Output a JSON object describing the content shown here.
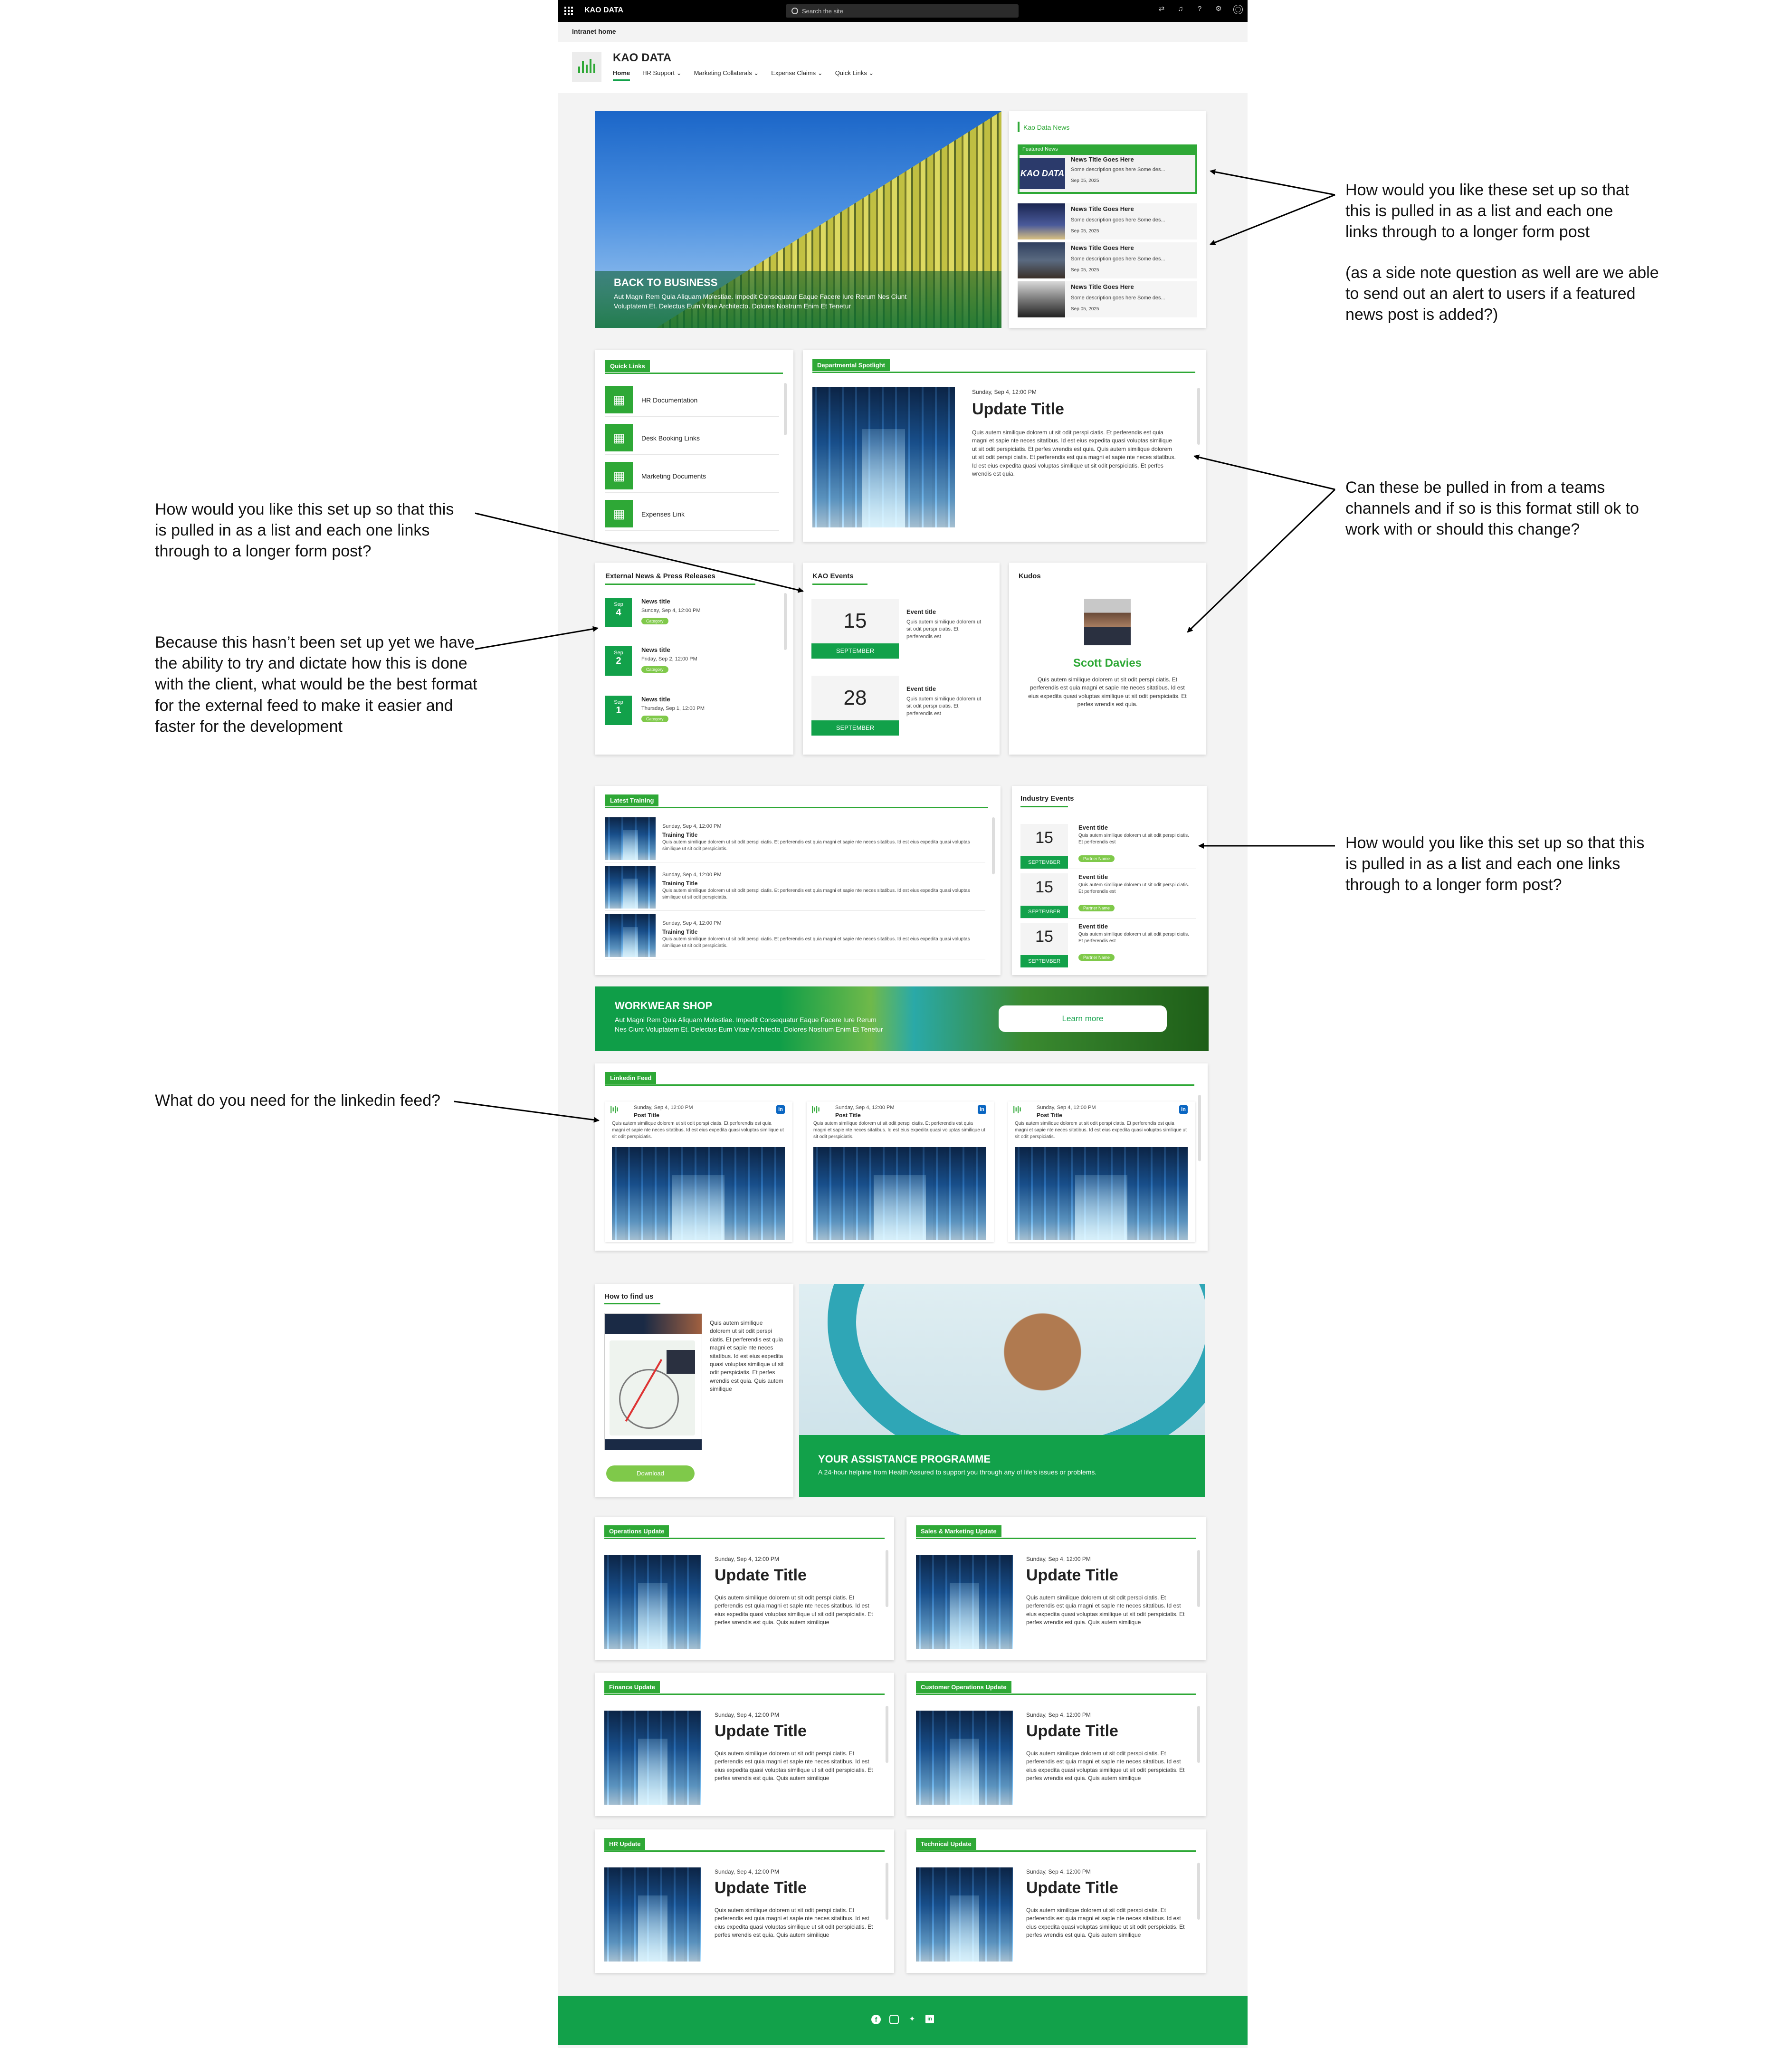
{
  "topbar": {
    "brand": "KAO DATA",
    "search_placeholder": "Search the site",
    "icons": [
      "share-icon",
      "bell-icon",
      "help-icon",
      "settings-icon",
      "account-icon"
    ]
  },
  "breadcrumb": "Intranet home",
  "header": {
    "title": "KAO DATA",
    "nav": [
      "Home",
      "HR Support",
      "Marketing Collaterals",
      "Expense Claims",
      "Quick Links"
    ]
  },
  "hero": {
    "title": "BACK TO BUSINESS",
    "text_line1": "Aut Magni Rem Quia Aliquam Molestiae. Impedit Consequatur Eaque Facere Iure Rerum Nes Ciunt",
    "text_line2": "Voluptatem Et. Delectus Eum Vitae Architecto. Dolores Nostrum Enim Et Tenetur"
  },
  "news": {
    "heading": "Kao Data News",
    "featured_label": "Featured News",
    "items": [
      {
        "title": "News Title Goes Here",
        "desc": "Some description goes here Some des...",
        "date": "Sep 05, 2025"
      },
      {
        "title": "News Title Goes Here",
        "desc": "Some description goes here Some des...",
        "date": "Sep 05, 2025"
      },
      {
        "title": "News Title Goes Here",
        "desc": "Some description goes here Some des...",
        "date": "Sep 05, 2025"
      },
      {
        "title": "News Title Goes Here",
        "desc": "Some description goes here Some des...",
        "date": "Sep 05, 2025"
      }
    ]
  },
  "quick_links": {
    "heading": "Quick Links",
    "items": [
      "HR Documentation",
      "Desk Booking Links",
      "Marketing Documents",
      "Expenses Link"
    ]
  },
  "spotlight": {
    "heading": "Departmental Spotlight",
    "date": "Sunday, Sep 4, 12:00 PM",
    "title": "Update Title",
    "body": "Quis autem similique dolorem ut sit odit perspi ciatis. Et perferendis est quia magni et sapie nte neces sitatibus. Id est eius expedita quasi voluptas similique ut sit odit perspiciatis. Et perfes wrendis est quia. Quis autem similique dolorem ut sit odit perspi ciatis. Et perferendis est quia magni et sapie nte neces sitatibus. Id est eius expedita quasi voluptas similique ut sit odit perspiciatis. Et perfes wrendis est quia."
  },
  "external_news": {
    "heading": "External News & Press Releases",
    "items": [
      {
        "month": "Sep",
        "day": "4",
        "title": "News title",
        "date": "Sunday, Sep 4, 12:00 PM",
        "tag": "Category"
      },
      {
        "month": "Sep",
        "day": "2",
        "title": "News title",
        "date": "Friday, Sep 2, 12:00 PM",
        "tag": "Category"
      },
      {
        "month": "Sep",
        "day": "1",
        "title": "News title",
        "date": "Thursday, Sep 1, 12:00 PM",
        "tag": "Category"
      }
    ]
  },
  "kao_events": {
    "heading": "KAO Events",
    "items": [
      {
        "day": "15",
        "month": "SEPTEMBER",
        "title": "Event title",
        "desc": "Quis autem similique dolorem ut sit odit perspi ciatis. Et perferendis est"
      },
      {
        "day": "28",
        "month": "SEPTEMBER",
        "title": "Event title",
        "desc": "Quis autem similique dolorem ut sit odit perspi ciatis. Et perferendis est"
      }
    ]
  },
  "kudos": {
    "heading": "Kudos",
    "name": "Scott Davies",
    "body": "Quis autem similique dolorem ut sit odit perspi ciatis. Et perferendis est quia magni et sapie nte neces sitatibus. Id est eius expedita quasi voluptas similique ut sit odit perspiciatis. Et perfes wrendis est quia."
  },
  "training": {
    "heading": "Latest Training",
    "items": [
      {
        "date": "Sunday, Sep 4, 12:00 PM",
        "title": "Training Title",
        "body": "Quis autem similique dolorem ut sit odit perspi ciatis. Et perferendis est quia magni et sapie nte neces sitatibus. Id est eius expedita quasi voluptas similique ut sit odit perspiciatis."
      },
      {
        "date": "Sunday, Sep 4, 12:00 PM",
        "title": "Training Title",
        "body": "Quis autem similique dolorem ut sit odit perspi ciatis. Et perferendis est quia magni et sapie nte neces sitatibus. Id est eius expedita quasi voluptas similique ut sit odit perspiciatis."
      },
      {
        "date": "Sunday, Sep 4, 12:00 PM",
        "title": "Training Title",
        "body": "Quis autem similique dolorem ut sit odit perspi ciatis. Et perferendis est quia magni et sapie nte neces sitatibus. Id est eius expedita quasi voluptas similique ut sit odit perspiciatis."
      }
    ]
  },
  "industry_events": {
    "heading": "Industry Events",
    "items": [
      {
        "day": "15",
        "month": "SEPTEMBER",
        "title": "Event title",
        "desc": "Quis autem similique dolorem ut sit odit perspi ciatis. Et perferendis est",
        "tag": "Partner Name"
      },
      {
        "day": "15",
        "month": "SEPTEMBER",
        "title": "Event title",
        "desc": "Quis autem similique dolorem ut sit odit perspi ciatis. Et perferendis est",
        "tag": "Partner Name"
      },
      {
        "day": "15",
        "month": "SEPTEMBER",
        "title": "Event title",
        "desc": "Quis autem similique dolorem ut sit odit perspi ciatis. Et perferendis est",
        "tag": "Partner Name"
      }
    ]
  },
  "workwear": {
    "title": "WORKWEAR SHOP",
    "line1": "Aut Magni Rem Quia Aliquam Molestiae. Impedit Consequatur Eaque Facere Iure Rerum",
    "line2": "Nes Ciunt Voluptatem Et. Delectus Eum Vitae Architecto. Dolores Nostrum Enim Et Tenetur",
    "button": "Learn more"
  },
  "linkedin": {
    "heading": "Linkedin Feed",
    "posts": [
      {
        "date": "Sunday, Sep 4, 12:00 PM",
        "title": "Post Title",
        "body": "Quis autem similique dolorem ut sit odit perspi ciatis. Et perferendis est quia magni et sapie nte neces sitatibus. Id est eius expedita quasi voluptas similique ut sit odit perspiciatis."
      },
      {
        "date": "Sunday, Sep 4, 12:00 PM",
        "title": "Post Title",
        "body": "Quis autem similique dolorem ut sit odit perspi ciatis. Et perferendis est quia magni et sapie nte neces sitatibus. Id est eius expedita quasi voluptas similique ut sit odit perspiciatis."
      },
      {
        "date": "Sunday, Sep 4, 12:00 PM",
        "title": "Post Title",
        "body": "Quis autem similique dolorem ut sit odit perspi ciatis. Et perferendis est quia magni et sapie nte neces sitatibus. Id est eius expedita quasi voluptas similique ut sit odit perspiciatis."
      }
    ]
  },
  "find_us": {
    "heading": "How to find us",
    "body": "Quis autem similique dolorem ut sit odit perspi ciatis. Et perferendis est quia magni et sapie nte neces sitatibus. Id est eius expedita quasi voluptas similique ut sit odit perspiciatis. Et perfes wrendis est quia. Quis autem similique",
    "button": "Download"
  },
  "assistance": {
    "title": "YOUR ASSISTANCE PROGRAMME",
    "body": "A 24-hour helpline from Health Assured to support you through any of life's issues or problems."
  },
  "updates": [
    {
      "heading": "Operations Update",
      "date": "Sunday, Sep 4, 12:00 PM",
      "title": "Update Title",
      "body": "Quis autem similique dolorem ut sit odit perspi ciatis. Et perferendis est quia magni et saple nte neces sitatibus. Id est eius expedita quasi voluptas similique ut sit odit perspiciatis. Et perfes wrendis est quia. Quis autem similique"
    },
    {
      "heading": "Sales & Marketing Update",
      "date": "Sunday, Sep 4, 12:00 PM",
      "title": "Update Title",
      "body": "Quis autem similique dolorem ut sit odit perspi ciatis. Et perferendis est quia magni et saple nte neces sitatibus. Id est eius expedita quasi voluptas similique ut sit odit perspiciatis. Et perfes wrendis est quia. Quis autem similique"
    },
    {
      "heading": "Finance Update",
      "date": "Sunday, Sep 4, 12:00 PM",
      "title": "Update Title",
      "body": "Quis autem similique dolorem ut sit odit perspi ciatis. Et perferendis est quia magni et saple nte neces sitatibus. Id est eius expedita quasi voluptas similique ut sit odit perspiciatis. Et perfes wrendis est quia. Quis autem similique"
    },
    {
      "heading": "Customer Operations Update",
      "date": "Sunday, Sep 4, 12:00 PM",
      "title": "Update Title",
      "body": "Quis autem similique dolorem ut sit odit perspi ciatis. Et perferendis est quia magni et saple nte neces sitatibus. Id est eius expedita quasi voluptas similique ut sit odit perspiciatis. Et perfes wrendis est quia. Quis autem similique"
    },
    {
      "heading": "HR Update",
      "date": "Sunday, Sep 4, 12:00 PM",
      "title": "Update Title",
      "body": "Quis autem similique dolorem ut sit odit perspi ciatis. Et perferendis est quia magni et saple nte neces sitatibus. Id est eius expedita quasi voluptas similique ut sit odit perspiciatis. Et perfes wrendis est quia. Quis autem similique"
    },
    {
      "heading": "Technical Update",
      "date": "Sunday, Sep 4, 12:00 PM",
      "title": "Update Title",
      "body": "Quis autem similique dolorem ut sit odit perspi ciatis. Et perferendis est quia magni et saple nte neces sitatibus. Id est eius expedita quasi voluptas similique ut sit odit perspiciatis. Et perfes wrendis est quia. Quis autem similique"
    }
  ],
  "footer": {
    "icons": [
      "facebook-icon",
      "instagram-icon",
      "twitter-icon",
      "linkedin-icon"
    ]
  },
  "annotations": {
    "news_q": "How would you like these set up so that this is pulled in as a list and each one links through to a longer form post",
    "news_side": "(as a side note question as well are we able to send out an alert to users if a featured news post is added?)",
    "teams_q": "Can these be pulled in from a teams channels and if so is this format still ok to work with or should this change?",
    "external_q": "How would you like this set up so that this is pulled in as a list and each one links through to a longer form post?",
    "external_note": "Because this hasn’t been set up yet we have the ability to try and dictate how this is done with the client, what would be the best format for the external feed to make it easier and faster for the development",
    "industry_q": "How would you like this set up so that this is pulled in as a list and each one links through to a longer form post?",
    "linkedin_q": "What do you need for the linkedin feed?"
  },
  "colors": {
    "green": "#2ea836",
    "dark_green": "#12a14a",
    "black": "#000000"
  }
}
